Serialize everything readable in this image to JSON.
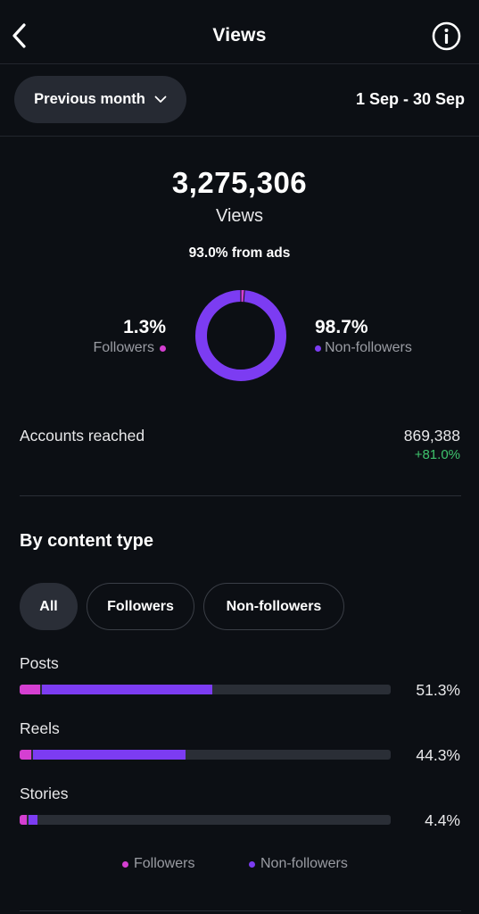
{
  "header": {
    "title": "Views",
    "back_icon": "chevron-left-icon",
    "info_icon": "info-icon"
  },
  "period": {
    "selected": "Previous month",
    "date_range": "1 Sep - 30 Sep"
  },
  "summary": {
    "total_views": "3,275,306",
    "total_label": "Views",
    "ads_note": "93.0% from ads",
    "followers_pct": "1.3%",
    "followers_label": "Followers",
    "non_followers_pct": "98.7%",
    "non_followers_label": "Non-followers",
    "followers_share": 0.013,
    "non_followers_share": 0.987
  },
  "accounts_reached": {
    "label": "Accounts reached",
    "value": "869,388",
    "change": "+81.0%"
  },
  "content_type": {
    "title": "By content type",
    "filters": [
      "All",
      "Followers",
      "Non-followers"
    ],
    "active_filter": "All",
    "rows": [
      {
        "label": "Posts",
        "pct": "51.3%",
        "followers_share": 0.055,
        "non_followers_share": 0.458
      },
      {
        "label": "Reels",
        "pct": "44.3%",
        "followers_share": 0.031,
        "non_followers_share": 0.412
      },
      {
        "label": "Stories",
        "pct": "4.4%",
        "followers_share": 0.019,
        "non_followers_share": 0.025
      }
    ],
    "legend": {
      "followers": "Followers",
      "non_followers": "Non-followers"
    }
  },
  "colors": {
    "followers": "#d53fd1",
    "non_followers": "#7c3cf2",
    "positive": "#3ec46d",
    "track": "#2a2e36"
  }
}
